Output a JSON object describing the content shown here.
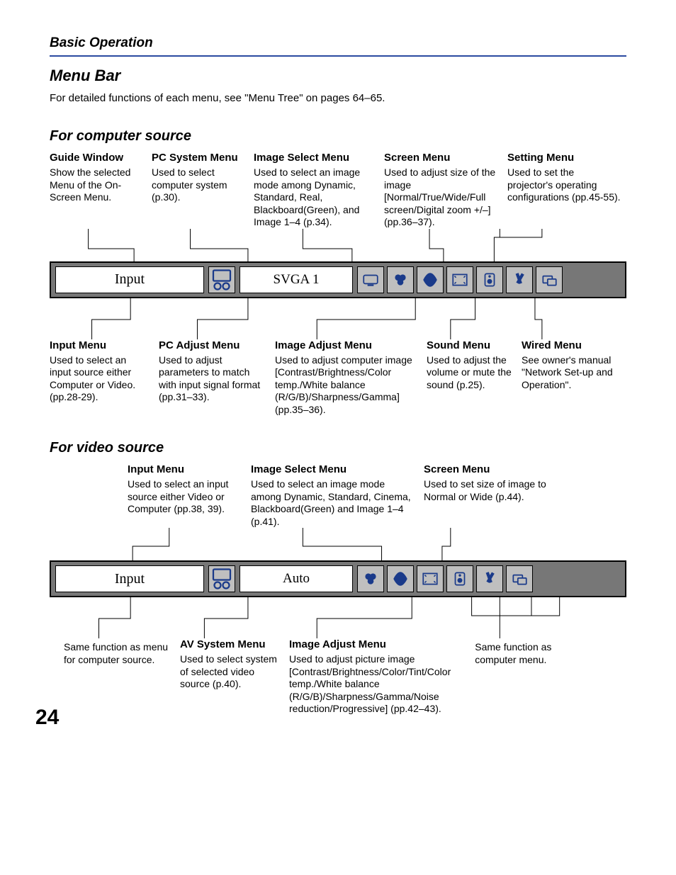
{
  "kicker": "Basic Operation",
  "section": "Menu Bar",
  "intro": "For detailed functions of each menu, see \"Menu Tree\" on pages 64–65.",
  "page_number": "24",
  "computer": {
    "heading": "For computer source",
    "top_labels": [
      {
        "title": "Guide Window",
        "desc": "Show the selected Menu of the On-Screen Menu."
      },
      {
        "title": "PC System Menu",
        "desc": "Used to select computer system (p.30)."
      },
      {
        "title": "Image Select Menu",
        "desc": "Used to select an image mode among Dynamic, Standard, Real, Blackboard(Green), and Image 1–4 (p.34)."
      },
      {
        "title": "Screen Menu",
        "desc": "Used to adjust size of the image [Normal/True/Wide/Full screen/Digital zoom +/–] (pp.36–37)."
      },
      {
        "title": "Setting Menu",
        "desc": "Used to set the projector's operating configurations (pp.45-55)."
      }
    ],
    "bar": {
      "input_label": "Input",
      "mode_label": "SVGA 1"
    },
    "bottom_labels": [
      {
        "title": "Input Menu",
        "desc": "Used to select an input source either Computer or Video. (pp.28-29)."
      },
      {
        "title": "PC Adjust Menu",
        "desc": "Used to adjust parameters to match with input signal format (pp.31–33)."
      },
      {
        "title": "Image Adjust Menu",
        "desc": "Used to adjust computer image [Contrast/Brightness/Color temp./White balance (R/G/B)/Sharpness/Gamma] (pp.35–36)."
      },
      {
        "title": "Sound Menu",
        "desc": "Used to adjust the volume or mute the sound (p.25)."
      },
      {
        "title": "Wired Menu",
        "desc": "See owner's manual \"Network Set-up and Operation\"."
      }
    ]
  },
  "video": {
    "heading": "For video source",
    "top_labels": [
      {
        "title": "Input Menu",
        "desc": "Used to select an input source either Video or Computer (pp.38, 39)."
      },
      {
        "title": "Image Select Menu",
        "desc": "Used to select an image mode among Dynamic, Standard, Cinema, Blackboard(Green) and Image 1–4 (p.41)."
      },
      {
        "title": "Screen Menu",
        "desc": "Used to set size of image to Normal or Wide (p.44)."
      }
    ],
    "bar": {
      "input_label": "Input",
      "mode_label": "Auto"
    },
    "bottom_labels": [
      {
        "title": "",
        "desc": "Same function as menu for computer source."
      },
      {
        "title": "AV System Menu",
        "desc": "Used to select system of selected video source (p.40)."
      },
      {
        "title": "Image Adjust Menu",
        "desc": "Used to adjust picture image [Contrast/Brightness/Color/Tint/Color temp./White balance (R/G/B)/Sharpness/Gamma/Noise reduction/Progressive] (pp.42–43)."
      },
      {
        "title": "",
        "desc": "Same function as computer menu."
      }
    ]
  }
}
